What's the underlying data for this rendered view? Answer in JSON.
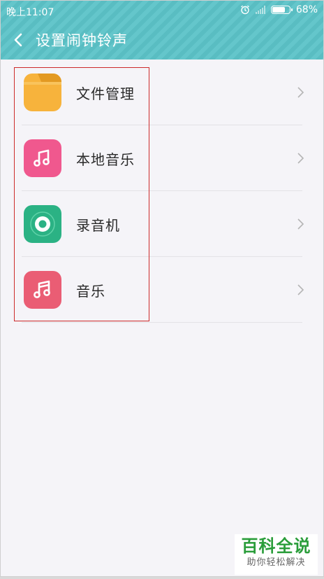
{
  "status_bar": {
    "time": "晚上11:07",
    "battery": "68%",
    "battery_level": 0.68,
    "icons": [
      "alarm-icon",
      "signal-icon",
      "battery-icon"
    ]
  },
  "header": {
    "title": "设置闹钟铃声",
    "back_icon": "back-chevron-icon"
  },
  "items": [
    {
      "label": "文件管理",
      "icon": "folder-icon",
      "color": "#f7b33c"
    },
    {
      "label": "本地音乐",
      "icon": "music-note-icon",
      "color": "#f0588e"
    },
    {
      "label": "录音机",
      "icon": "recorder-icon",
      "color": "#2bb284"
    },
    {
      "label": "音乐",
      "icon": "music-icon",
      "color": "#ea5d74"
    }
  ],
  "colors": {
    "header_bg": "#5cc3c8",
    "page_bg": "#f5f4f8",
    "highlight": "#cc2a2a"
  },
  "watermark": {
    "main": "百科全说",
    "sub": "助你轻松解决"
  }
}
